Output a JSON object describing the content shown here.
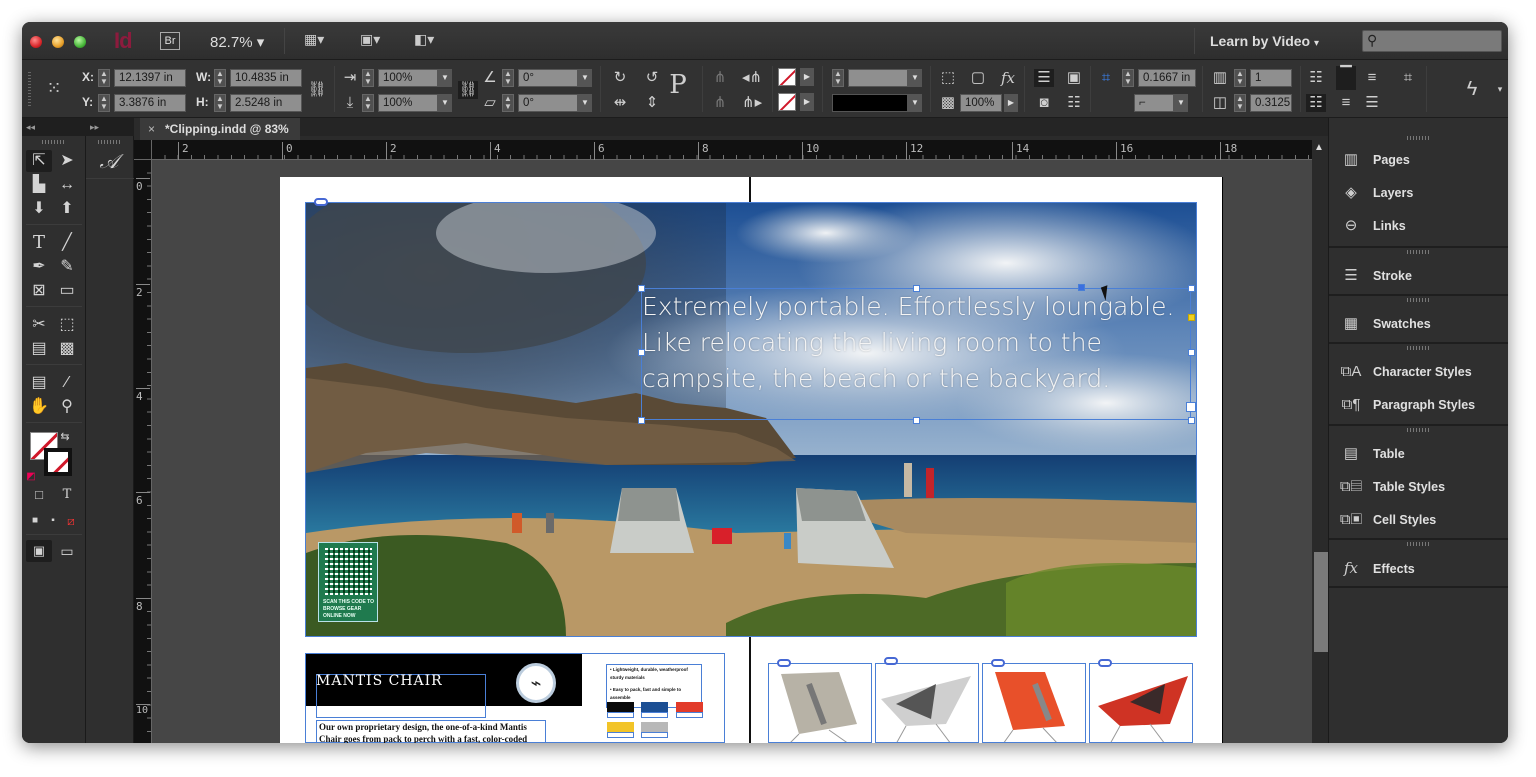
{
  "app": {
    "logo": "Id",
    "bridge_button": "Br",
    "zoom_level": "82.7%",
    "workspace": "Learn by Video",
    "search_placeholder": ""
  },
  "control_bar": {
    "x_label": "X:",
    "x_value": "12.1397 in",
    "y_label": "Y:",
    "y_value": "3.3876 in",
    "w_label": "W:",
    "w_value": "10.4835 in",
    "h_label": "H:",
    "h_value": "2.5248 in",
    "scale_x": "100%",
    "scale_y": "100%",
    "rotate_angle": "0°",
    "shear_angle": "0°",
    "stroke_weight": "",
    "opacity": "100%",
    "inset_spacing": "0.1667 in",
    "columns": "1",
    "gutter": "0.3125"
  },
  "document": {
    "tab_title": "*Clipping.indd @ 83%",
    "close_icon": "×"
  },
  "rulers": {
    "horizontal_ticks": [
      "2",
      "0",
      "2",
      "4",
      "6",
      "8",
      "10",
      "12",
      "14",
      "16",
      "18"
    ],
    "vertical_ticks": [
      "0",
      "2",
      "4",
      "6",
      "8",
      "10"
    ]
  },
  "layout": {
    "headline": "Extremely portable. Effortlessly loungable. Like relocating the living room to the campsite, the beach or the backyard.",
    "qr_caption": "SCAN THIS CODE TO BROWSE GEAR ONLINE NOW",
    "product_title": "MANTIS CHAIR",
    "product_body": "Our own proprietary design, the one-of-a-kind Mantis Chair goes from pack to perch with a fast, color-coded assembly process. The strong,",
    "bullets": [
      "Lightweight, durable, weatherproof sturdy materials",
      "Easy to pack, fast and simple to assemble"
    ],
    "color_swatches": [
      {
        "name": "Black",
        "color": "#0a0a0a"
      },
      {
        "name": "Blue",
        "color": "#1c4f94"
      },
      {
        "name": "Red",
        "color": "#e23b2a"
      },
      {
        "name": "Yellow",
        "color": "#f2c428"
      },
      {
        "name": "Camo",
        "color": "#b8b8b8"
      }
    ],
    "chairs": [
      {
        "name": "camo-chair",
        "color": "#b7b2a6"
      },
      {
        "name": "grey-chair",
        "color": "#cfcfcf"
      },
      {
        "name": "orange-chair",
        "color": "#e8502a"
      },
      {
        "name": "red-chair",
        "color": "#cf3324"
      }
    ]
  },
  "panels": {
    "group1": [
      "Pages",
      "Layers",
      "Links"
    ],
    "group2": [
      "Stroke"
    ],
    "group3": [
      "Swatches"
    ],
    "group4": [
      "Character Styles",
      "Paragraph Styles"
    ],
    "group5": [
      "Table",
      "Table Styles",
      "Cell Styles"
    ],
    "group6": [
      "Effects"
    ]
  }
}
